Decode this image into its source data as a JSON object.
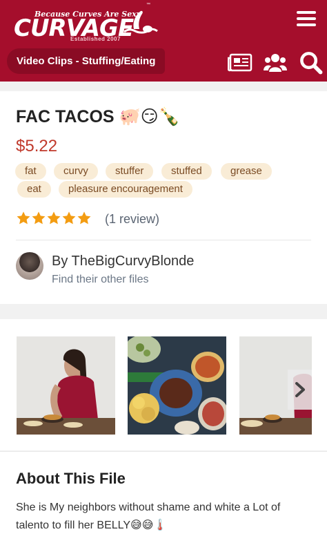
{
  "header": {
    "logo_tagline": "Because Curves Are Sexy",
    "logo_wordmark": "CURVAGE",
    "logo_established": "Established 2007",
    "logo_tm": "™",
    "breadcrumb": "Video Clips - Stuffing/Eating",
    "icons": [
      "menu-icon",
      "news-icon",
      "users-icon",
      "search-icon"
    ],
    "brand_color": "#a50e2c"
  },
  "product": {
    "title": "FAC TACOS 🐖😏🍾",
    "price": "$5.22",
    "tags": [
      "fat",
      "curvy",
      "stuffer",
      "stuffed",
      "grease",
      "eat",
      "pleasure encouragement"
    ],
    "rating": 5,
    "review_count": "(1 review)",
    "author_line": "By TheBigCurvyBlonde",
    "author_link": "Find their other files"
  },
  "gallery": {
    "thumbnails": [
      "woman-at-table",
      "tacos-and-dishes",
      "woman-partial"
    ]
  },
  "about": {
    "heading": "About This File",
    "text": "She is My neighbors without shame and white a Lot of talento to fill her BELLY😅😅🌡️"
  }
}
